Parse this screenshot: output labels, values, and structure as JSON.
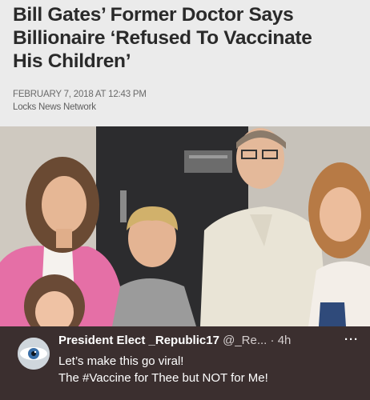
{
  "article": {
    "headline_lines": [
      "Bill Gates’ Former Doctor Says",
      "Billionaire ‘Refused To Vaccinate",
      "His Children’"
    ],
    "date": "FEBRUARY 7, 2018 AT 12:43 PM",
    "source": "Locks News Network"
  },
  "photo": {
    "description_icon": "family-photo"
  },
  "post": {
    "display_name": "President Elect _Republic17",
    "handle": "@_Re...",
    "separator": " · ",
    "time": "4h",
    "more": "···",
    "line1": "Let’s make this go viral!",
    "line2": "The #Vaccine for Thee but NOT for Me!"
  },
  "colors": {
    "header_bg": "#ebebeb",
    "headline": "#2a2a2a",
    "post_bg": "#3b2f2f",
    "post_text": "#ffffff"
  }
}
